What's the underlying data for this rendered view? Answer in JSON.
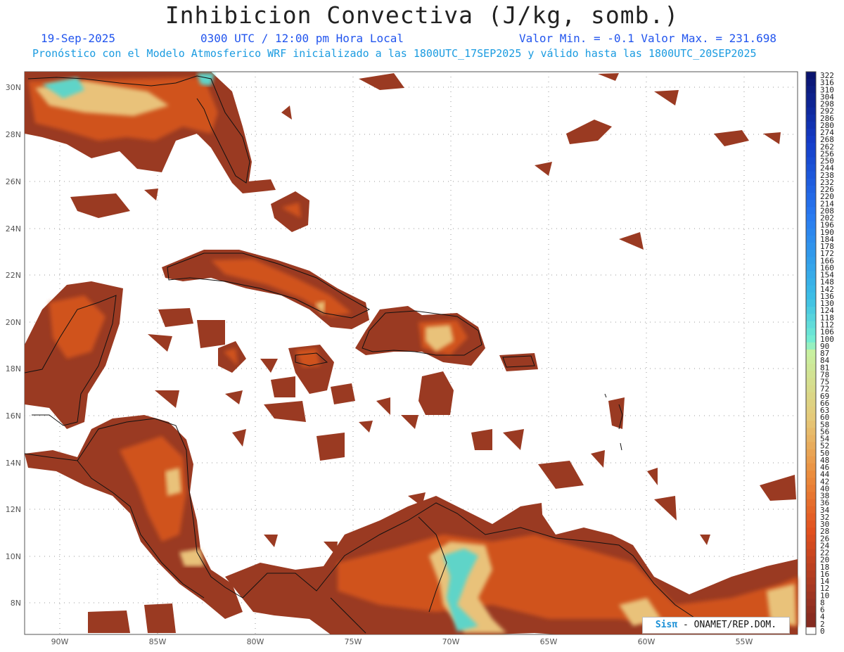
{
  "header": {
    "title": "Inhibicion Convectiva (J/kg, somb.)",
    "date": "19-Sep-2025",
    "time": "0300 UTC / 12:00 pm Hora Local",
    "minmax": "Valor Min. = -0.1  Valor Max. = 231.698",
    "model_line": "Pronóstico con el Modelo Atmosferico WRF inicializado a las 1800UTC_17SEP2025 y válido hasta las  1800UTC_20SEP2025"
  },
  "map": {
    "lon_ticks": [
      "90W",
      "85W",
      "80W",
      "75W",
      "70W",
      "65W",
      "60W",
      "55W"
    ],
    "lat_ticks": [
      "30N",
      "28N",
      "26N",
      "24N",
      "22N",
      "20N",
      "18N",
      "16N",
      "14N",
      "12N",
      "10N",
      "8N"
    ]
  },
  "colorbar": {
    "labels": [
      "322",
      "316",
      "310",
      "304",
      "298",
      "292",
      "286",
      "280",
      "274",
      "268",
      "262",
      "256",
      "250",
      "244",
      "238",
      "232",
      "226",
      "220",
      "214",
      "208",
      "202",
      "196",
      "190",
      "184",
      "178",
      "172",
      "166",
      "160",
      "154",
      "148",
      "142",
      "136",
      "130",
      "124",
      "118",
      "112",
      "106",
      "100",
      "90",
      "87",
      "84",
      "81",
      "78",
      "75",
      "72",
      "69",
      "66",
      "63",
      "60",
      "58",
      "56",
      "54",
      "52",
      "50",
      "48",
      "46",
      "44",
      "42",
      "40",
      "38",
      "36",
      "34",
      "32",
      "30",
      "28",
      "26",
      "24",
      "22",
      "20",
      "18",
      "16",
      "14",
      "12",
      "10",
      "8",
      "6",
      "4",
      "2",
      "0"
    ]
  },
  "credit": {
    "brand": "Sisπ",
    "text": "- ONAMET/REP.DOM."
  }
}
